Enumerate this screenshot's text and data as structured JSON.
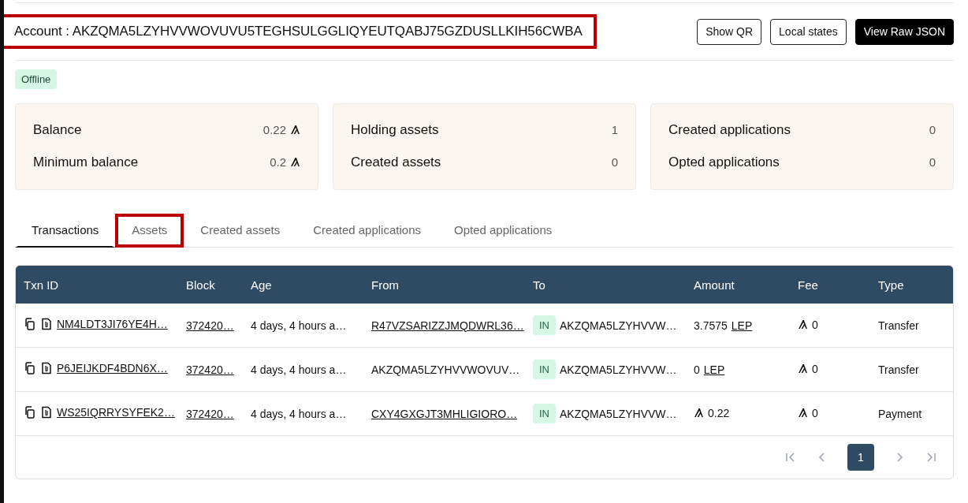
{
  "account": {
    "label": "Account :",
    "address": "AKZQMA5LZYHVVWOVUVU5TEGHSULGGLIQYEUTQABJ75GZDUSLLKIH56CWBA",
    "highlighted": true
  },
  "buttons": [
    {
      "label": "Show QR",
      "kind": "outline"
    },
    {
      "label": "Local states",
      "kind": "outline"
    },
    {
      "label": "View Raw JSON",
      "kind": "primary"
    }
  ],
  "status_badge": "Offline",
  "summary_cards": [
    {
      "rows": [
        {
          "label": "Balance",
          "value": "0.22",
          "kind": "algo"
        },
        {
          "label": "Minimum balance",
          "value": "0.2",
          "kind": "algo"
        }
      ]
    },
    {
      "rows": [
        {
          "label": "Holding assets",
          "value": "1",
          "kind": "count"
        },
        {
          "label": "Created assets",
          "value": "0",
          "kind": "count"
        }
      ]
    },
    {
      "rows": [
        {
          "label": "Created applications",
          "value": "0",
          "kind": "count"
        },
        {
          "label": "Opted applications",
          "value": "0",
          "kind": "count"
        }
      ]
    }
  ],
  "tabs": [
    {
      "label": "Transactions",
      "selected": true,
      "highlighted": false
    },
    {
      "label": "Assets",
      "selected": false,
      "highlighted": true
    },
    {
      "label": "Created assets",
      "selected": false,
      "highlighted": false
    },
    {
      "label": "Created applications",
      "selected": false,
      "highlighted": false
    },
    {
      "label": "Opted applications",
      "selected": false,
      "highlighted": false
    }
  ],
  "table": {
    "columns": [
      "Txn ID",
      "Block",
      "Age",
      "From",
      "To",
      "Amount",
      "Fee",
      "Type"
    ],
    "rows": [
      {
        "txn_id": "NM4LDT3JI76YE4H…",
        "block": "372420…",
        "age": "4 days, 4 hours a…",
        "from": "R47VZSARIZZJMQDWRL36…",
        "from_link": true,
        "direction": "IN",
        "to": "AKZQMA5LZYHVVW…",
        "amount": "3.7575",
        "kind": "asset",
        "unit": "LEP",
        "fee": "0",
        "type": "Transfer"
      },
      {
        "txn_id": "P6JEIJKDF4BDN6X…",
        "block": "372420…",
        "age": "4 days, 4 hours a…",
        "from": "AKZQMA5LZYHVVWOVUV…",
        "from_link": false,
        "direction": "IN",
        "to": "AKZQMA5LZYHVVW…",
        "amount": "0",
        "kind": "asset",
        "unit": "LEP",
        "fee": "0",
        "type": "Transfer"
      },
      {
        "txn_id": "WS25IQRRYSYFEK2…",
        "block": "372420…",
        "age": "4 days, 4 hours a…",
        "from": "CXY4GXGJT3MHLIGIORO…",
        "from_link": true,
        "direction": "IN",
        "to": "AKZQMA5LZYHVVW…",
        "amount": "0.22",
        "kind": "algo",
        "fee": "0",
        "type": "Payment"
      }
    ]
  },
  "pagination": {
    "pages": [
      {
        "label": "1",
        "selected": true
      }
    ]
  }
}
